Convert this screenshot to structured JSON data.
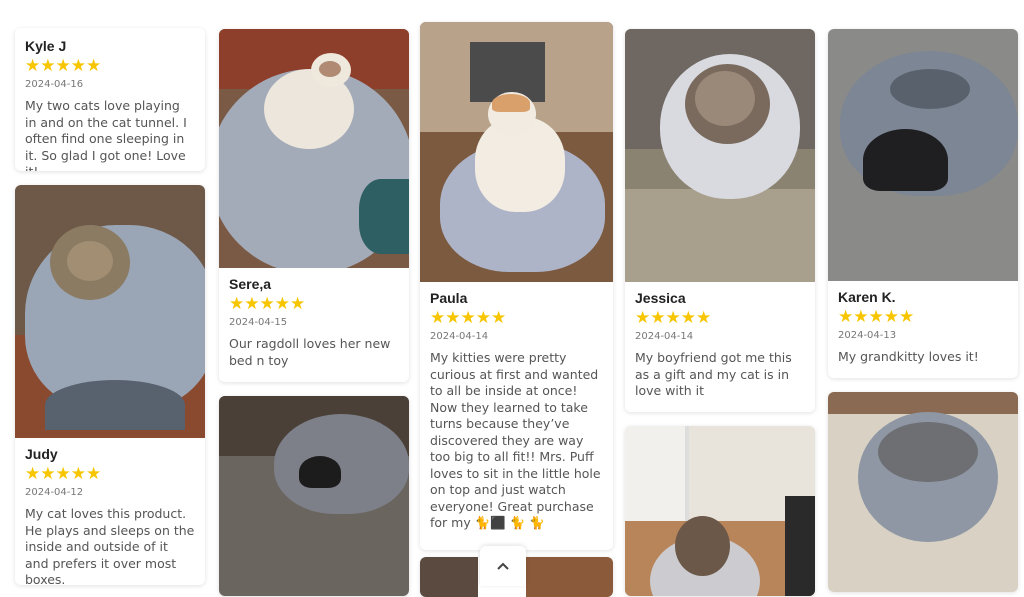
{
  "reviews": [
    {
      "name": "Kyle J",
      "stars": "★★★★★",
      "date": "2024-04-16",
      "text": "My two cats love playing in and on the cat tunnel. I often find one sleeping in it. So glad I got one! Love it!"
    },
    {
      "name": "Judy",
      "stars": "★★★★★",
      "date": "2024-04-12",
      "text": "My cat loves this product. He plays and sleeps on the inside and outside of it and prefers it over most boxes."
    },
    {
      "name": "Sere,a",
      "stars": "★★★★★",
      "date": "2024-04-15",
      "text": "Our ragdoll loves her new bed n toy"
    },
    {
      "name": "Paula",
      "stars": "★★★★★",
      "date": "2024-04-14",
      "text": "My kitties were pretty curious at first and wanted to all be inside at once! Now they learned to take turns because they’ve discovered they are way too big to all fit!! Mrs. Puff loves to sit in the little hole on top and just watch everyone! Great purchase for my 🐈⬛ 🐈 🐈"
    },
    {
      "name": "Jessica",
      "stars": "★★★★★",
      "date": "2024-04-14",
      "text": "My boyfriend got me this as a gift and my cat is in love with it"
    },
    {
      "name": "Karen K.",
      "stars": "★★★★★",
      "date": "2024-04-13",
      "text": "My grandkitty loves it!"
    }
  ],
  "colors": {
    "star": "#f7c600",
    "felt": "#9aa3b3"
  },
  "icons": {
    "scroll_up": "chevron-up-icon"
  }
}
